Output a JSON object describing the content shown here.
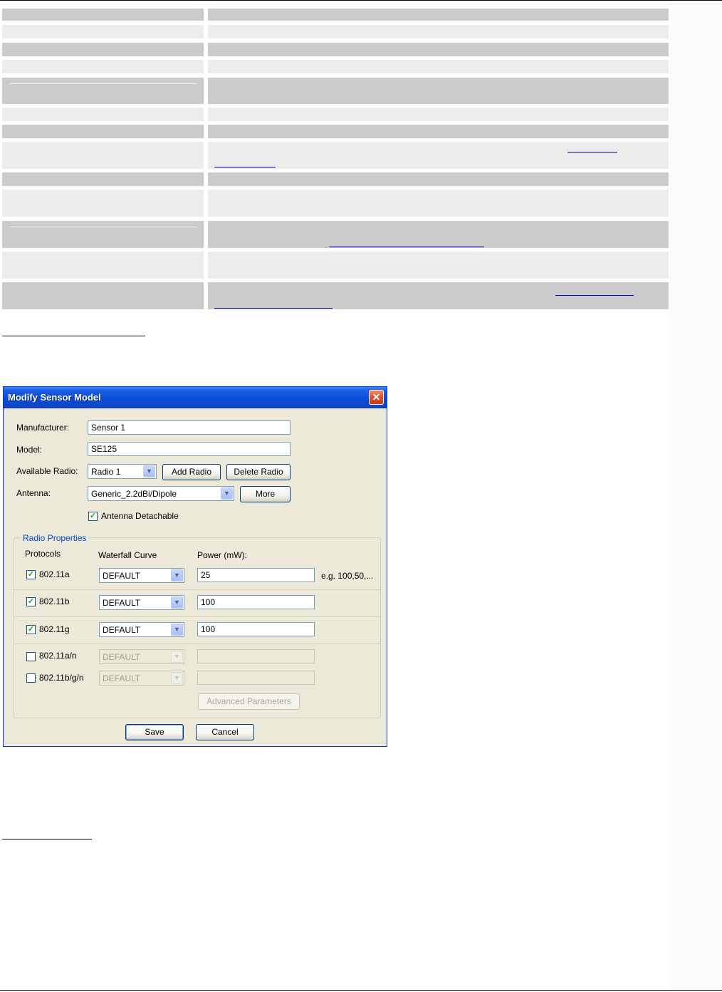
{
  "document": {
    "section_heading_1": "",
    "section_heading_2": ""
  },
  "dialog": {
    "title": "Modify Sensor Model",
    "close_glyph": "✕",
    "manufacturer": {
      "label": "Manufacturer:",
      "value": "Sensor 1"
    },
    "model": {
      "label": "Model:",
      "value": "SE125"
    },
    "available_radio": {
      "label": "Available Radio:",
      "value": "Radio 1"
    },
    "add_radio_label": "Add Radio",
    "delete_radio_label": "Delete Radio",
    "antenna": {
      "label": "Antenna:",
      "value": "Generic_2.2dBi/Dipole"
    },
    "more_label": "More",
    "antenna_detachable": {
      "label": "Antenna Detachable",
      "checked": true
    },
    "radio_properties": {
      "legend": "Radio Properties",
      "col_protocols": "Protocols",
      "col_waterfall": "Waterfall Curve",
      "col_power": "Power (mW):",
      "power_hint": "e.g. 100,50,...",
      "rows": [
        {
          "protocol": "802.11a",
          "checked": true,
          "curve": "DEFAULT",
          "power": "25",
          "enabled": true
        },
        {
          "protocol": "802.11b",
          "checked": true,
          "curve": "DEFAULT",
          "power": "100",
          "enabled": true
        },
        {
          "protocol": "802.11g",
          "checked": true,
          "curve": "DEFAULT",
          "power": "100",
          "enabled": true
        },
        {
          "protocol": "802.11a/n",
          "checked": false,
          "curve": "DEFAULT",
          "power": "",
          "enabled": false
        },
        {
          "protocol": "802.11b/g/n",
          "checked": false,
          "curve": "DEFAULT",
          "power": "",
          "enabled": false
        }
      ],
      "advanced_label": "Advanced Parameters"
    },
    "save_label": "Save",
    "cancel_label": "Cancel",
    "check_glyph": "✓",
    "arrow_glyph": "▼"
  }
}
